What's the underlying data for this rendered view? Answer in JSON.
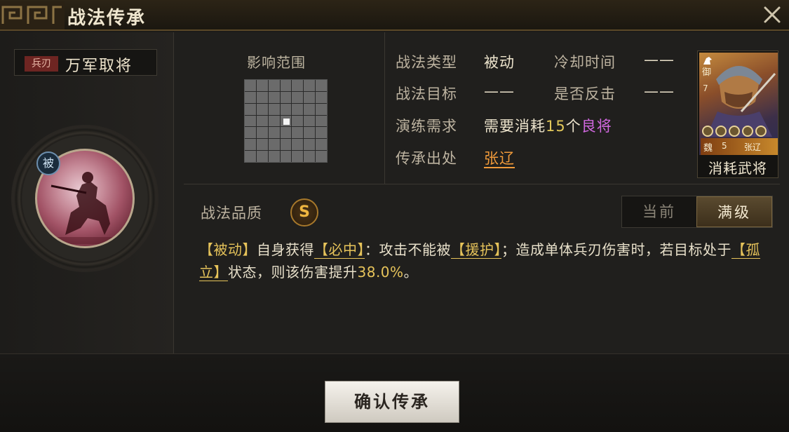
{
  "title": "战法传承",
  "icons": {
    "close": "close-icon",
    "ornament": "fret-ornament-icon"
  },
  "skill": {
    "type_tag": "兵刃",
    "name": "万军取将",
    "passive_badge": "被"
  },
  "range": {
    "label": "影响范围"
  },
  "info": {
    "type_label": "战法类型",
    "type_value": "被动",
    "cooldown_label": "冷却时间",
    "cooldown_value": "——",
    "target_label": "战法目标",
    "target_value": "——",
    "counter_label": "是否反击",
    "counter_value": "——",
    "train_label": "演练需求",
    "train_prefix": "需要消耗",
    "train_count": "15",
    "train_unit": "个",
    "train_quality": "良将",
    "source_label": "传承出处",
    "source_value": "张辽"
  },
  "general_card": {
    "role": "御",
    "cost": "7",
    "faction": "魏",
    "level": "5",
    "name": "张辽",
    "caption": "消耗武将",
    "stars": 5
  },
  "quality": {
    "label": "战法品质",
    "grade": "S"
  },
  "tabs": [
    {
      "label": "当前",
      "active": false
    },
    {
      "label": "满级",
      "active": true
    }
  ],
  "description": {
    "p1": "【被动】",
    "p2": "自身获得",
    "p3": "【必中】",
    "p4": "：攻击不能被",
    "p5": "【援护】",
    "p6": "；造成单体兵刃伤害时，若目标处于",
    "p7": "【孤立】",
    "p8": "状态，则该伤害提升",
    "p9": "38.0%",
    "p10": "。"
  },
  "confirm_button": "确认传承",
  "colors": {
    "accent_gold": "#e6c35a",
    "quality_purple": "#d168e0",
    "link_orange": "#f09a3a",
    "type_tag_red": "#6e2522"
  }
}
